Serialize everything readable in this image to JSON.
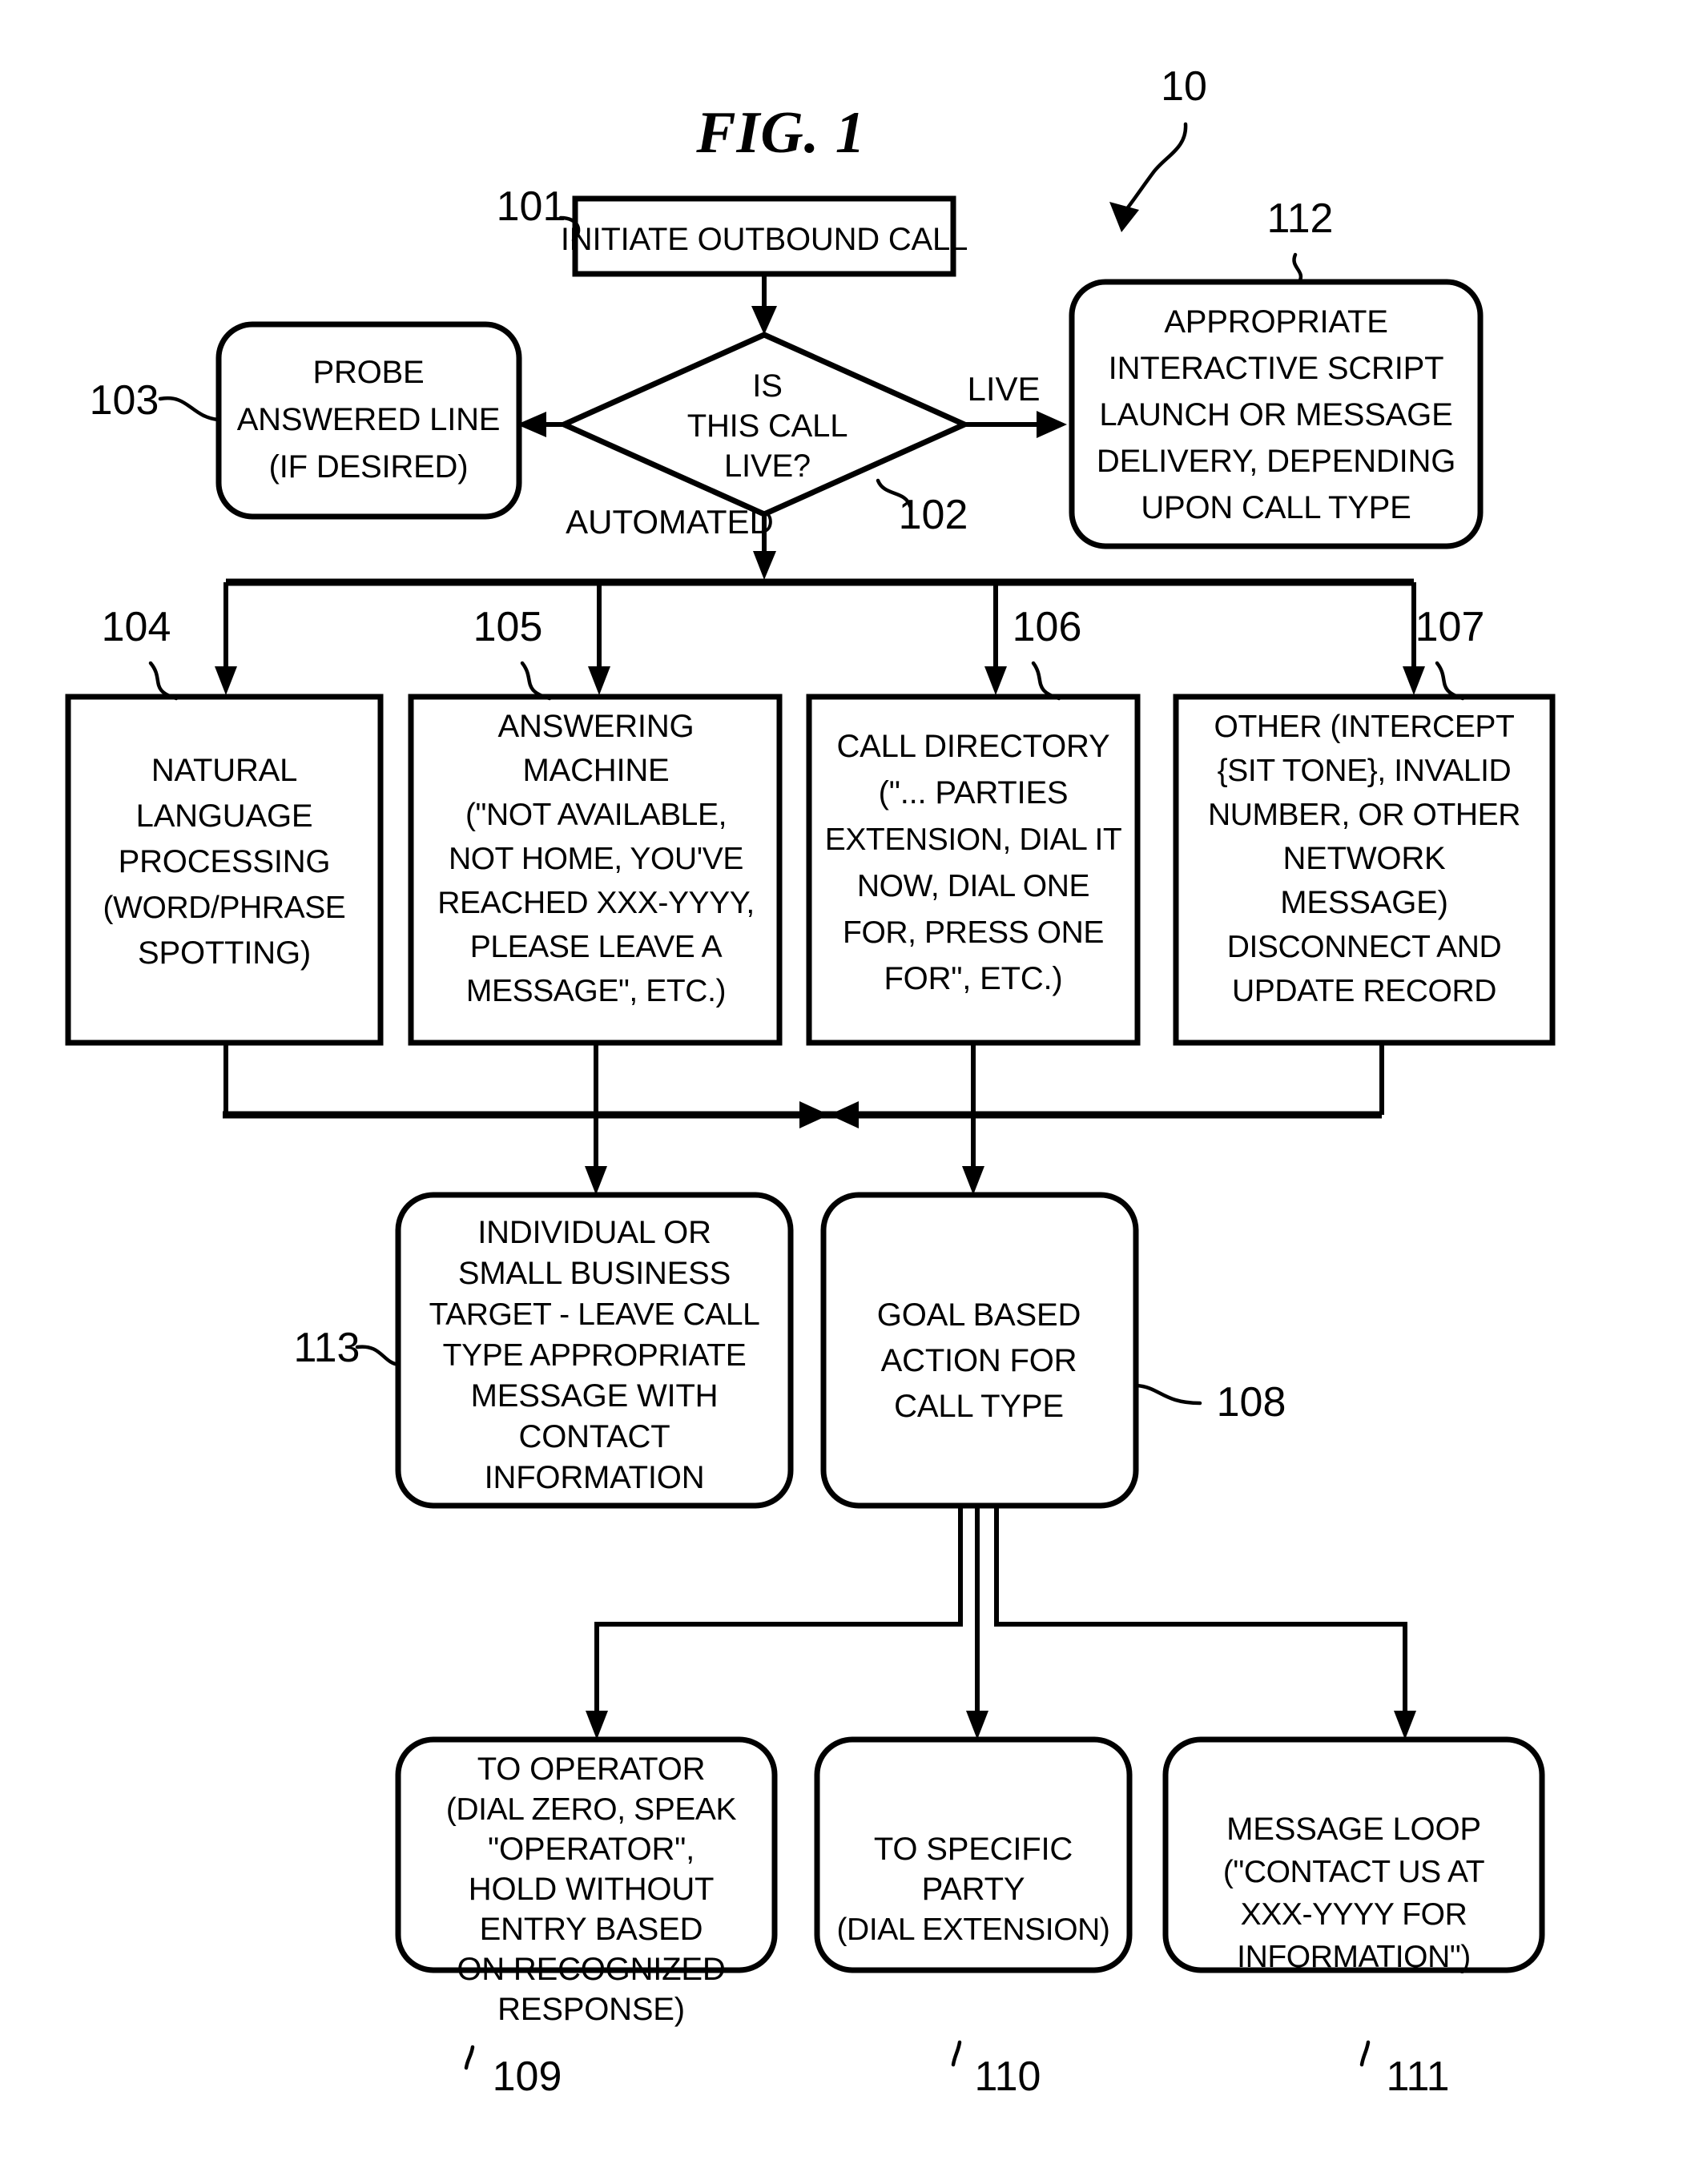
{
  "figure": {
    "title": "FIG. 1",
    "system_ref": "10"
  },
  "edge_labels": {
    "live": "LIVE",
    "automated": "AUTOMATED"
  },
  "nodes": [
    {
      "id": "101",
      "ref": "101",
      "shape": "rect",
      "name": "initiate-outbound-call",
      "lines": [
        "INITIATE OUTBOUND CALL"
      ]
    },
    {
      "id": "102",
      "ref": "102",
      "shape": "diamond",
      "name": "is-this-call-live-decision",
      "lines": [
        "IS",
        "THIS CALL",
        "LIVE?"
      ]
    },
    {
      "id": "103",
      "ref": "103",
      "shape": "rounded",
      "name": "probe-answered-line",
      "lines": [
        "PROBE",
        "ANSWERED LINE",
        "(IF DESIRED)"
      ]
    },
    {
      "id": "112",
      "ref": "112",
      "shape": "rounded",
      "name": "interactive-script-launch",
      "lines": [
        "APPROPRIATE",
        "INTERACTIVE SCRIPT",
        "LAUNCH OR MESSAGE",
        "DELIVERY, DEPENDING",
        "UPON CALL TYPE"
      ]
    },
    {
      "id": "104",
      "ref": "104",
      "shape": "rect",
      "name": "natural-language-processing",
      "lines": [
        "NATURAL",
        "LANGUAGE",
        "PROCESSING",
        "(WORD/PHRASE",
        "SPOTTING)"
      ]
    },
    {
      "id": "105",
      "ref": "105",
      "shape": "rect",
      "name": "answering-machine",
      "lines": [
        "ANSWERING",
        "MACHINE",
        "(\"NOT AVAILABLE,",
        "NOT HOME, YOU'VE",
        "REACHED XXX-YYYY,",
        "PLEASE LEAVE A",
        "MESSAGE\", ETC.)"
      ]
    },
    {
      "id": "106",
      "ref": "106",
      "shape": "rect",
      "name": "call-directory",
      "lines": [
        "CALL DIRECTORY",
        "(\"... PARTIES",
        "EXTENSION, DIAL IT",
        "NOW, DIAL ONE",
        "FOR, PRESS ONE",
        "FOR\", ETC.)"
      ]
    },
    {
      "id": "107",
      "ref": "107",
      "shape": "rect",
      "name": "other-network-message",
      "lines": [
        "OTHER (INTERCEPT",
        "{SIT TONE}, INVALID",
        "NUMBER, OR OTHER",
        "NETWORK",
        "MESSAGE)",
        "DISCONNECT AND",
        "UPDATE RECORD"
      ]
    },
    {
      "id": "113",
      "ref": "113",
      "shape": "rounded",
      "name": "individual-small-business-target",
      "lines": [
        "INDIVIDUAL OR",
        "SMALL BUSINESS",
        "TARGET - LEAVE CALL",
        "TYPE APPROPRIATE",
        "MESSAGE WITH",
        "CONTACT",
        "INFORMATION"
      ]
    },
    {
      "id": "108",
      "ref": "108",
      "shape": "rounded",
      "name": "goal-based-action",
      "lines": [
        "GOAL BASED",
        "ACTION FOR",
        "CALL TYPE"
      ]
    },
    {
      "id": "109",
      "ref": "109",
      "shape": "rounded",
      "name": "to-operator",
      "lines": [
        "TO OPERATOR",
        "(DIAL ZERO, SPEAK",
        "\"OPERATOR\",",
        "HOLD WITHOUT",
        "ENTRY BASED",
        "ON RECOGNIZED",
        "RESPONSE)"
      ]
    },
    {
      "id": "110",
      "ref": "110",
      "shape": "rounded",
      "name": "to-specific-party",
      "lines": [
        "TO SPECIFIC",
        "PARTY",
        "(DIAL EXTENSION)"
      ]
    },
    {
      "id": "111",
      "ref": "111",
      "shape": "rounded",
      "name": "message-loop",
      "lines": [
        "MESSAGE LOOP",
        "(\"CONTACT US AT",
        "XXX-YYYY FOR",
        "INFORMATION\")"
      ]
    }
  ]
}
